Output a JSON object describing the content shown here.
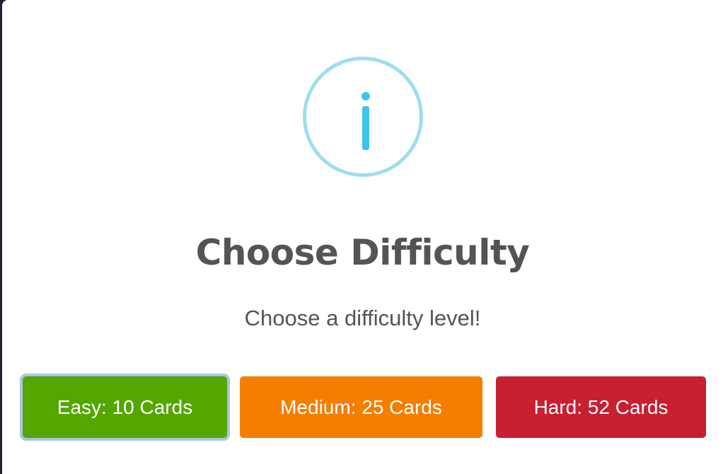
{
  "dialog": {
    "icon": "info-icon",
    "title": "Choose Difficulty",
    "message": "Choose a difficulty level!",
    "buttons": {
      "easy": "Easy: 10 Cards",
      "medium": "Medium: 25 Cards",
      "hard": "Hard: 52 Cards"
    }
  },
  "colors": {
    "icon_ring": "#9fdcf1",
    "icon_glyph": "#3fc3ee",
    "text": "#545454",
    "easy": "#54a600",
    "medium": "#f37e00",
    "hard": "#c81f31",
    "focus_ring": "#a8c7e4"
  }
}
